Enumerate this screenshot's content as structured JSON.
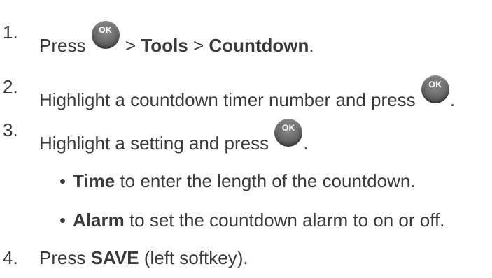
{
  "steps": [
    {
      "number": "1.",
      "parts": [
        "Press",
        "",
        ">",
        "Tools",
        ">",
        "Countdown",
        "."
      ]
    },
    {
      "number": "2.",
      "parts": [
        "Highlight a countdown timer number and press",
        "",
        "."
      ]
    },
    {
      "number": "3.",
      "parts": [
        "Highlight a setting and press",
        "",
        "."
      ]
    },
    {
      "number": "4.",
      "parts": [
        "Press",
        "SAVE",
        "(left softkey)."
      ]
    }
  ],
  "sub_items": [
    {
      "term": "Time",
      "desc": "to enter the length of the countdown."
    },
    {
      "term": "Alarm",
      "desc": "to set the countdown alarm to on or off."
    }
  ],
  "ok_key": {
    "label": "OK",
    "icon": "ok-button-icon"
  }
}
